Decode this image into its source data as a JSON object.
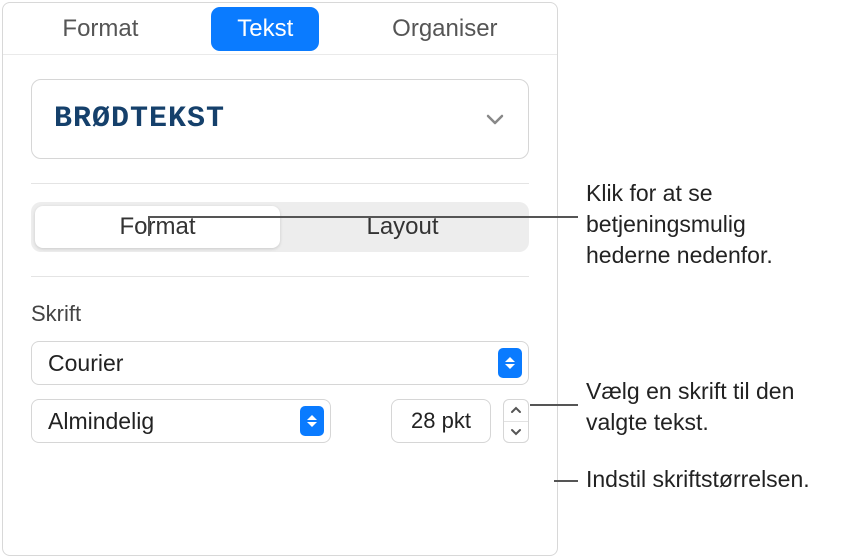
{
  "main_tabs": {
    "format": "Format",
    "tekst": "Tekst",
    "organiser": "Organiser"
  },
  "style": {
    "name": "BRØDTEKST"
  },
  "sub_tabs": {
    "format": "Format",
    "layout": "Layout"
  },
  "font": {
    "section_label": "Skrift",
    "family": "Courier",
    "weight": "Almindelig",
    "size": "28 pkt"
  },
  "callouts": {
    "subtab": "Klik for at se betjeningsmulig hederne nedenfor.",
    "font_family": "Vælg en skrift til den valgte tekst.",
    "font_size": "Indstil skriftstørrelsen."
  }
}
